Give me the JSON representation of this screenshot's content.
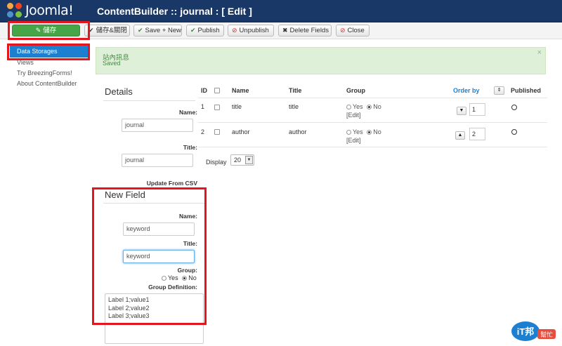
{
  "header": {
    "logo_text": "Joomla!",
    "title": "ContentBuilder :: journal : [ Edit ]"
  },
  "toolbar": {
    "save": "儲存",
    "save_close": "儲存&關閉",
    "save_new": "Save + New",
    "publish": "Publish",
    "unpublish": "Unpublish",
    "delete_fields": "Delete Fields",
    "close": "Close"
  },
  "sidebar": {
    "items": [
      {
        "label": "Data Storages"
      },
      {
        "label": "Views"
      },
      {
        "label": "Try BreezingForms!"
      },
      {
        "label": "About ContentBuilder"
      }
    ]
  },
  "alert": {
    "title": "站內訊息",
    "message": "Saved",
    "close": "×"
  },
  "details": {
    "heading": "Details",
    "name_label": "Name:",
    "name_value": "journal",
    "title_label": "Title:",
    "title_value": "journal",
    "csv_label": "Update From CSV"
  },
  "table": {
    "headers": {
      "id": "ID",
      "name": "Name",
      "title": "Title",
      "group": "Group",
      "order_by": "Order by",
      "published": "Published"
    },
    "rows": [
      {
        "id": "1",
        "name": "title",
        "title": "title",
        "yes": "Yes",
        "no": "No",
        "edit": "[Edit]",
        "order": "1"
      },
      {
        "id": "2",
        "name": "author",
        "title": "author",
        "yes": "Yes",
        "no": "No",
        "edit": "[Edit]",
        "order": "2"
      }
    ],
    "display_label": "Display",
    "display_value": "20"
  },
  "new_field": {
    "heading": "New Field",
    "name_label": "Name:",
    "name_value": "keyword",
    "title_label": "Title:",
    "title_value": "keyword",
    "group_label": "Group:",
    "yes": "Yes",
    "no": "No",
    "group_def_label": "Group Definition:",
    "group_def_lines": [
      "Label 1;value1",
      "Label 2;value2",
      "Label 3;value3"
    ]
  },
  "watermark": {
    "text": "iT邦",
    "subtext": "幫忙"
  },
  "colors": {
    "header": "#1a3867",
    "save": "#46a546",
    "active": "#1d7fd0",
    "highlight": "#e3161e",
    "alert_bg": "#dff0d8"
  }
}
